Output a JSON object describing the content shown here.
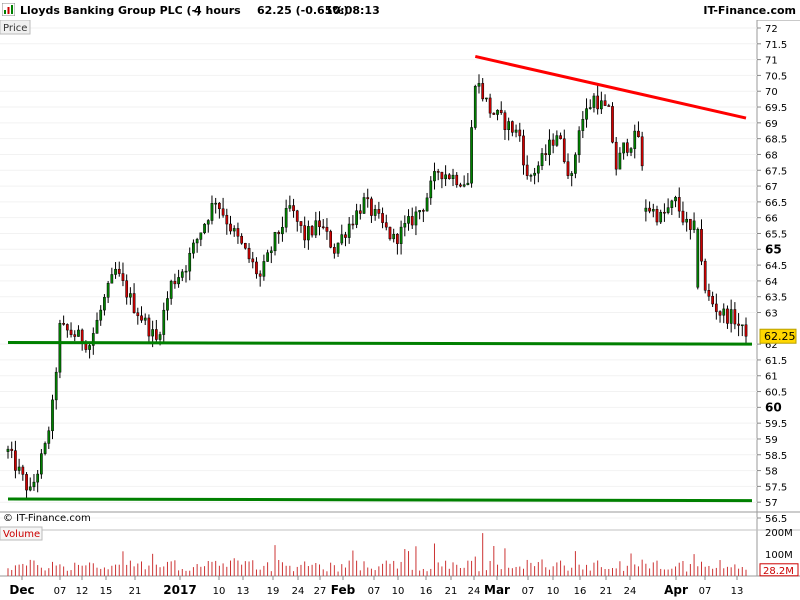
{
  "header": {
    "symbol": "Lloyds Banking Group PLC (-)",
    "interval": "4 hours",
    "last_change": "62.25 (-0.65%)",
    "time": "10:08:13",
    "brand": "IT-Finance.com"
  },
  "panel": {
    "price_label": "Price",
    "volume_label": "Volume",
    "watermark": "© IT-Finance.com"
  },
  "chart_data": {
    "type": "candlestick",
    "price_axis": {
      "ylim": [
        56.3,
        72.4
      ],
      "ticks": [
        {
          "v": 56.5,
          "label": "56.5"
        },
        {
          "v": 57,
          "label": "57"
        },
        {
          "v": 57.5,
          "label": "57.5"
        },
        {
          "v": 58,
          "label": "58"
        },
        {
          "v": 58.5,
          "label": "58.5"
        },
        {
          "v": 59,
          "label": "59"
        },
        {
          "v": 59.5,
          "label": "59.5"
        },
        {
          "v": 60,
          "label": "60",
          "bold": true
        },
        {
          "v": 60.5,
          "label": "60.5"
        },
        {
          "v": 61,
          "label": "61"
        },
        {
          "v": 61.5,
          "label": "61.5"
        },
        {
          "v": 62,
          "label": "62"
        },
        {
          "v": 63,
          "label": "63"
        },
        {
          "v": 63.5,
          "label": "63.5"
        },
        {
          "v": 64,
          "label": "64"
        },
        {
          "v": 64.5,
          "label": "64.5"
        },
        {
          "v": 65,
          "label": "65",
          "bold": true
        },
        {
          "v": 65.5,
          "label": "65.5"
        },
        {
          "v": 66,
          "label": "66"
        },
        {
          "v": 66.5,
          "label": "66.5"
        },
        {
          "v": 67,
          "label": "67"
        },
        {
          "v": 67.5,
          "label": "67.5"
        },
        {
          "v": 68,
          "label": "68"
        },
        {
          "v": 68.5,
          "label": "68.5"
        },
        {
          "v": 69,
          "label": "69"
        },
        {
          "v": 69.5,
          "label": "69.5"
        },
        {
          "v": 70,
          "label": "70"
        },
        {
          "v": 70.5,
          "label": "70.5"
        },
        {
          "v": 71,
          "label": "71"
        },
        {
          "v": 71.5,
          "label": "71.5"
        },
        {
          "v": 72,
          "label": "72"
        }
      ]
    },
    "last_price": {
      "value": 62.25,
      "label": "62.25",
      "color": "#ffd700"
    },
    "volume_axis": {
      "ylim": [
        0,
        200
      ],
      "ticks": [
        {
          "v": 200,
          "label": "200M"
        },
        {
          "v": 100,
          "label": "100M"
        }
      ],
      "last": {
        "value": 28.2,
        "label": "28.2M",
        "color": "#cc0000"
      }
    },
    "x_ticks": [
      {
        "label": "Dec",
        "bold": true
      },
      {
        "label": "07"
      },
      {
        "label": "12"
      },
      {
        "label": "15"
      },
      {
        "label": "21"
      },
      {
        "label": "2017",
        "bold": true
      },
      {
        "label": "10"
      },
      {
        "label": "13"
      },
      {
        "label": "19"
      },
      {
        "label": "24"
      },
      {
        "label": "27"
      },
      {
        "label": "Feb",
        "bold": true
      },
      {
        "label": "07"
      },
      {
        "label": "10"
      },
      {
        "label": "16"
      },
      {
        "label": "21"
      },
      {
        "label": "24"
      },
      {
        "label": "Mar",
        "bold": true
      },
      {
        "label": "07"
      },
      {
        "label": "10"
      },
      {
        "label": "16"
      },
      {
        "label": "21"
      },
      {
        "label": "24"
      },
      {
        "label": "Apr",
        "bold": true
      },
      {
        "label": "07"
      },
      {
        "label": "13"
      }
    ],
    "price_path": [
      [
        0,
        58.6
      ],
      [
        6,
        57.3
      ],
      [
        10,
        58.7
      ],
      [
        12,
        60.0
      ],
      [
        14,
        62.5
      ],
      [
        18,
        62.3
      ],
      [
        22,
        62.0
      ],
      [
        26,
        63.4
      ],
      [
        29,
        64.3
      ],
      [
        34,
        63.2
      ],
      [
        38,
        62.5
      ],
      [
        40,
        62.1
      ],
      [
        44,
        63.9
      ],
      [
        48,
        64.5
      ],
      [
        52,
        65.6
      ],
      [
        56,
        66.6
      ],
      [
        60,
        65.7
      ],
      [
        64,
        64.9
      ],
      [
        68,
        64.1
      ],
      [
        72,
        65.3
      ],
      [
        76,
        66.3
      ],
      [
        80,
        65.4
      ],
      [
        84,
        65.8
      ],
      [
        88,
        65.0
      ],
      [
        92,
        65.8
      ],
      [
        96,
        66.5
      ],
      [
        100,
        65.9
      ],
      [
        104,
        65.3
      ],
      [
        108,
        65.8
      ],
      [
        112,
        66.4
      ],
      [
        116,
        67.5
      ],
      [
        120,
        67.3
      ],
      [
        124,
        67.1
      ],
      [
        126,
        70.4
      ],
      [
        130,
        69.4
      ],
      [
        134,
        69.0
      ],
      [
        138,
        68.6
      ],
      [
        140,
        67.2
      ],
      [
        144,
        67.8
      ],
      [
        148,
        68.7
      ],
      [
        152,
        67.2
      ],
      [
        154,
        68.9
      ],
      [
        158,
        69.8
      ],
      [
        162,
        69.3
      ],
      [
        164,
        67.6
      ],
      [
        166,
        68.2
      ],
      [
        170,
        68.6
      ],
      [
        172,
        66.4
      ],
      [
        176,
        66.0
      ],
      [
        180,
        66.5
      ],
      [
        184,
        65.5
      ],
      [
        186,
        65.8
      ],
      [
        188,
        63.6
      ],
      [
        192,
        63.0
      ],
      [
        196,
        62.8
      ],
      [
        198,
        62.4
      ],
      [
        199,
        62.25
      ]
    ],
    "gaps": [
      {
        "after": 171,
        "open": 66.2
      },
      {
        "after": 185,
        "open": 63.8
      }
    ],
    "trendlines": [
      {
        "name": "resistance",
        "color": "#ff0000",
        "from": [
          126,
          71.1
        ],
        "to": [
          199,
          69.15
        ]
      },
      {
        "name": "support-upper",
        "color": "#008000",
        "from": [
          0,
          62.05
        ],
        "to": [
          204,
          62.0
        ]
      },
      {
        "name": "support-lower",
        "color": "#008000",
        "from": [
          0,
          57.1
        ],
        "to": [
          204,
          57.05
        ]
      }
    ],
    "up_color": "#008000",
    "down_color": "#cc0000",
    "candle_count": 200
  }
}
